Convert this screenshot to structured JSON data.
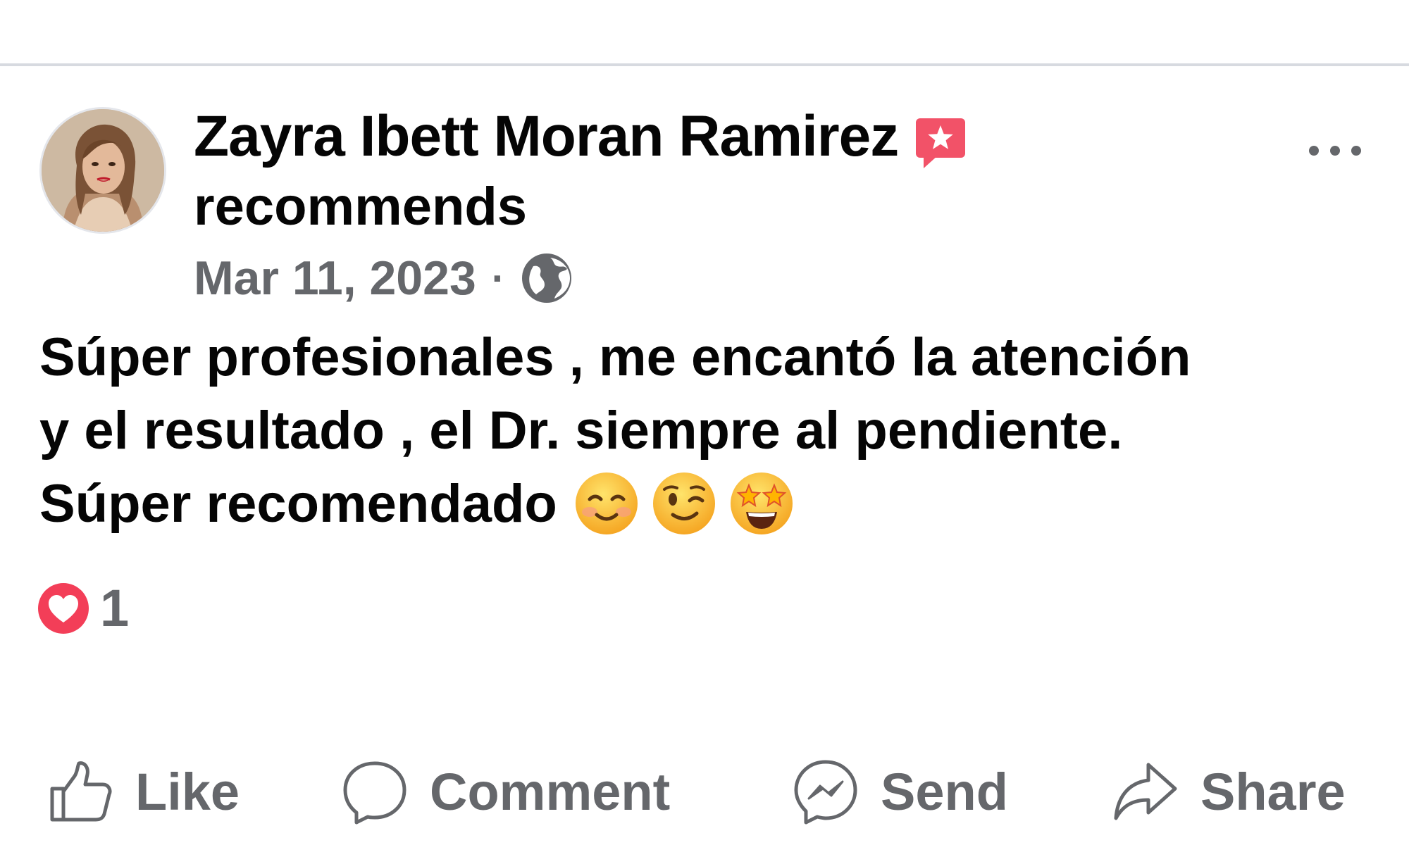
{
  "post": {
    "author_name": "Zayra Ibett Moran Ramirez",
    "action_text": "recommends",
    "date": "Mar 11, 2023",
    "separator": "·",
    "privacy_icon": "globe-icon",
    "recommendation_icon": "recommend-star-icon",
    "more_icon": "more-options-icon",
    "body_line_1": "Súper profesionales , me encantó la atención",
    "body_line_2": "y el resultado , el Dr. siempre al pendiente.",
    "body_line_3": "Súper recomendado",
    "emojis": [
      "smiling-face-emoji",
      "winking-face-emoji",
      "star-struck-emoji"
    ],
    "reaction_icon": "heart-reaction-icon",
    "reaction_count": "1"
  },
  "actions": {
    "like_label": "Like",
    "comment_label": "Comment",
    "send_label": "Send",
    "share_label": "Share"
  },
  "colors": {
    "text_primary": "#050505",
    "text_secondary": "#65676b",
    "divider": "#d7dae0",
    "recommend_badge": "#f25268",
    "heart_reaction": "#f33e58"
  }
}
